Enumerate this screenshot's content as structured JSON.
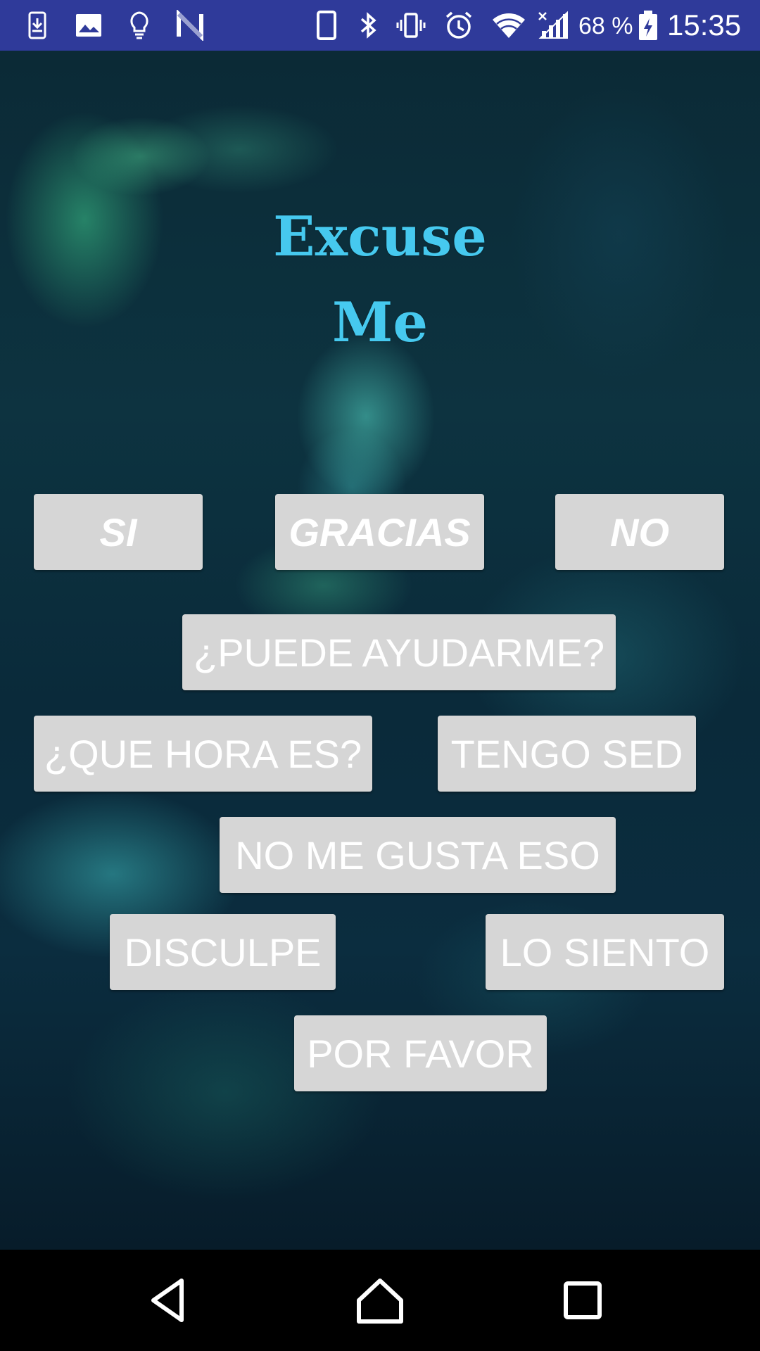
{
  "status_bar": {
    "battery_percent": "68 %",
    "time": "15:35",
    "left_icons": [
      "download-icon",
      "image-icon",
      "lightbulb-icon",
      "n-logo-icon"
    ],
    "right_icons": [
      "phone-icon",
      "bluetooth-icon",
      "vibrate-icon",
      "alarm-icon",
      "wifi-icon",
      "signal-icon",
      "battery-charging-icon"
    ],
    "background_color": "#2f3a9a"
  },
  "app": {
    "title_line1": "Excuse",
    "title_line2": "Me",
    "title_color": "#46c9ef",
    "button_color": "#d6d6d6",
    "buttons": {
      "si": "SI",
      "gracias": "GRACIAS",
      "no": "NO",
      "puede_ayudarme": "¿PUEDE AYUDARME?",
      "que_hora_es": "¿QUE HORA ES?",
      "tengo_sed": "TENGO SED",
      "no_me_gusta_eso": "NO ME GUSTA ESO",
      "disculpe": "DISCULPE",
      "lo_siento": "LO SIENTO",
      "por_favor": "POR FAVOR"
    }
  },
  "nav_bar": {
    "icons": [
      "back-icon",
      "home-icon",
      "recents-icon"
    ]
  }
}
